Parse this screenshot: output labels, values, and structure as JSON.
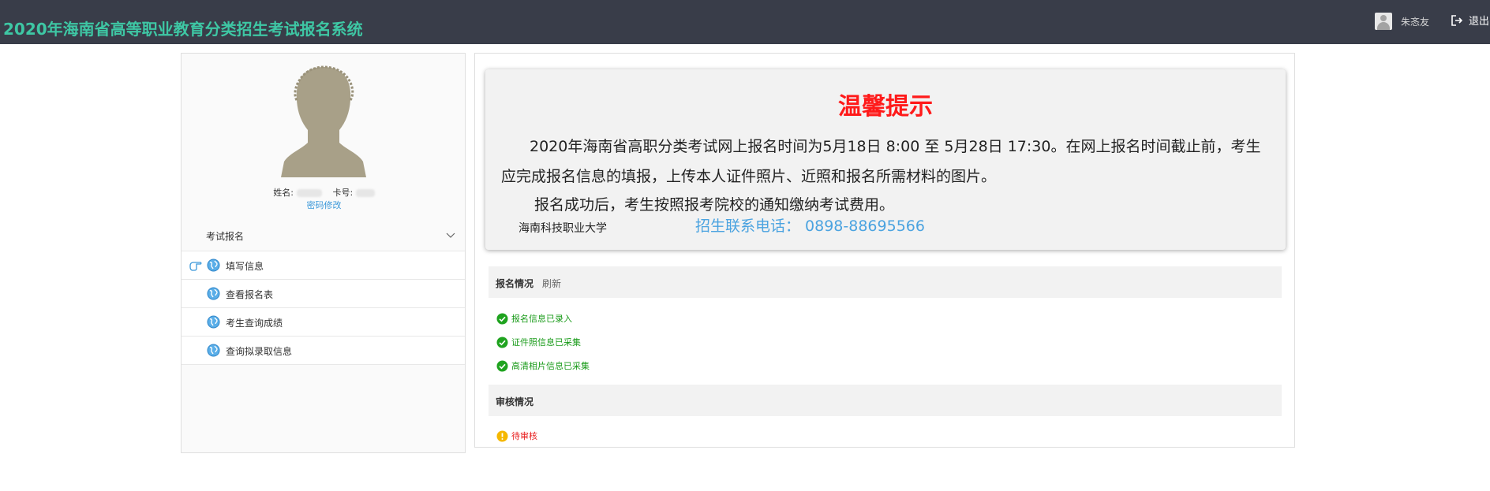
{
  "header": {
    "title": "2020年海南省高等职业教育分类招生考试报名系统",
    "username": "朱忞友",
    "logout_label": "退出"
  },
  "profile": {
    "name_label": "姓名:",
    "card_label": "卡号:",
    "password_link": "密码修改"
  },
  "sidebar": {
    "group_label": "考试报名",
    "items": [
      {
        "label": "填写信息",
        "icon": "globe-icon",
        "active": true
      },
      {
        "label": "查看报名表",
        "icon": "globe-icon"
      },
      {
        "label": "考生查询成绩",
        "icon": "globe-icon"
      },
      {
        "label": "查询拟录取信息",
        "icon": "globe-icon"
      }
    ]
  },
  "notice": {
    "title": "温馨提示",
    "paragraph1": "2020年海南省高职分类考试网上报名时间为5月18日 8:00 至 5月28日 17:30。在网上报名时间截止前，考生应完成报名信息的填报，上传本人证件照片、近照和报名所需材料的图片。",
    "paragraph2": "报名成功后，考生按照报考院校的通知缴纳考试费用。",
    "school": "海南科技职业大学",
    "phone": "招生联系电话：  0898-88695566"
  },
  "registration": {
    "title": "报名情况",
    "refresh_label": "刷新",
    "statuses": [
      {
        "label": "报名信息已录入",
        "state": "done"
      },
      {
        "label": "证件照信息已采集",
        "state": "done"
      },
      {
        "label": "高清相片信息已采集",
        "state": "done"
      }
    ]
  },
  "review": {
    "title": "审核情况",
    "status": {
      "label": "待审核",
      "state": "pending"
    }
  },
  "colors": {
    "topbar": "#393d49",
    "title_green": "#3ec7a4",
    "notice_red": "#ff1a1a",
    "phone_blue": "#4ba3e0",
    "success_green": "#1a9b1a",
    "pending_red": "#e81d1d",
    "warning_yellow": "#f5b800"
  }
}
